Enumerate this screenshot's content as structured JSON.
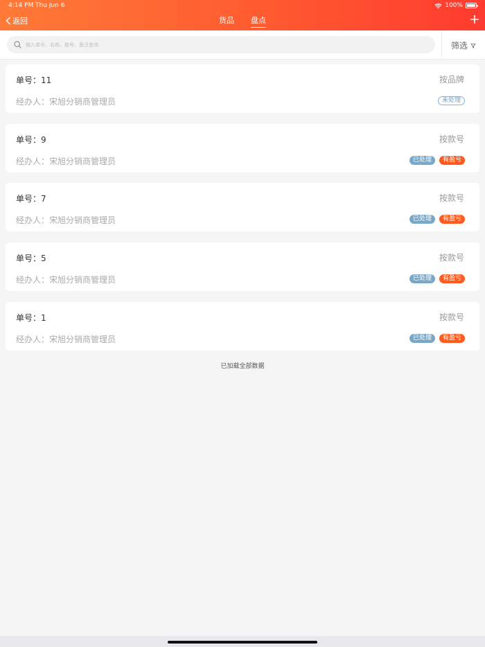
{
  "status_bar": {
    "time": "4:14 PM",
    "date": "Thu Jun 6",
    "battery": "100%"
  },
  "nav": {
    "back_label": "返回",
    "tabs": [
      {
        "label": "货品",
        "active": false
      },
      {
        "label": "盘点",
        "active": true
      }
    ]
  },
  "search": {
    "placeholder": "输入单号、名称、款号、备注查询",
    "value": ""
  },
  "filter": {
    "label": "筛选"
  },
  "orders": [
    {
      "order": "单号：11",
      "type": "按品牌",
      "handler": "经办人：宋旭分销商管理员",
      "badges": [
        "未处理"
      ]
    },
    {
      "order": "单号：9",
      "type": "按款号",
      "handler": "经办人：宋旭分销商管理员",
      "badges": [
        "已处理",
        "有盈亏"
      ]
    },
    {
      "order": "单号：7",
      "type": "按款号",
      "handler": "经办人：宋旭分销商管理员",
      "badges": [
        "已处理",
        "有盈亏"
      ]
    },
    {
      "order": "单号：5",
      "type": "按款号",
      "handler": "经办人：宋旭分销商管理员",
      "badges": [
        "已处理",
        "有盈亏"
      ]
    },
    {
      "order": "单号：1",
      "type": "按款号",
      "handler": "经办人：宋旭分销商管理员",
      "badges": [
        "已处理",
        "有盈亏"
      ]
    }
  ],
  "footer_text": "已加载全部数据",
  "colors": {
    "header_start": "#ff7a37",
    "header_end": "#ff3b2f",
    "processed_badge": "#79a7c7",
    "profit_badge": "#ff5a1f",
    "unprocessed_badge": "#7fb4d9"
  }
}
